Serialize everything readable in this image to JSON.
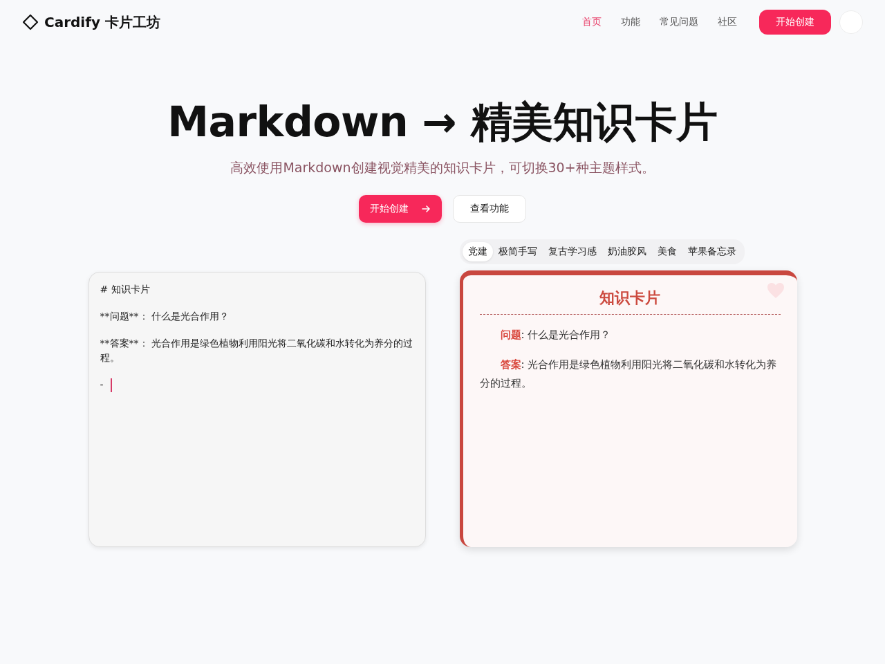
{
  "header": {
    "logo": "Cardify 卡片工坊",
    "nav": [
      {
        "label": "首页",
        "selected": true
      },
      {
        "label": "功能",
        "selected": false
      },
      {
        "label": "常见问题",
        "selected": false
      },
      {
        "label": "社区",
        "selected": false
      }
    ],
    "cta": "开始创建"
  },
  "hero": {
    "title": "Markdown → 精美知识卡片",
    "subtitle": "高效使用Markdown创建视觉精美的知识卡片，可切换30+种主题样式。",
    "buttons": [
      {
        "label": "开始创建",
        "kind": "primary"
      },
      {
        "label": "查看功能",
        "kind": "secondary"
      }
    ]
  },
  "editor": {
    "lines": [
      "#  知识卡片",
      "**问题**：  什么是光合作用？",
      "**答案**：  光合作用是绿色植物利用阳光将二氧化碳和水转化为养分的过程。",
      "-"
    ]
  },
  "themes": [
    {
      "label": "党建",
      "selected": true
    },
    {
      "label": "极简手写",
      "selected": false
    },
    {
      "label": "复古学习感",
      "selected": false
    },
    {
      "label": "奶油胶风",
      "selected": false
    },
    {
      "label": "美食",
      "selected": false
    },
    {
      "label": "苹果备忘录",
      "selected": false
    }
  ],
  "card": {
    "title": "知识卡片",
    "paragraphs": [
      "**问题**: 什么是光合作用？",
      "**答案**: 光合作用是绿色植物利用阳光将二氧化碳和水转化为养分的过程。"
    ]
  }
}
